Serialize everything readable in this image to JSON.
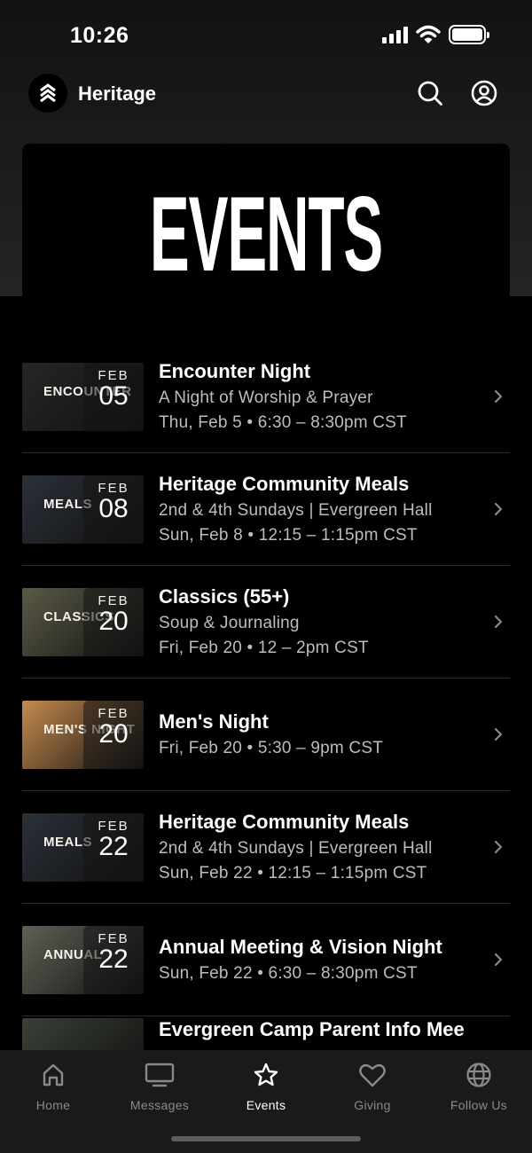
{
  "status_bar": {
    "time": "10:26"
  },
  "header": {
    "app_name": "Heritage"
  },
  "banner": {
    "title": "EVENTS"
  },
  "events": [
    {
      "title": "Encounter Night",
      "lines": [
        "A Night of Worship & Prayer",
        "Thu, Feb 5 • 6:30 – 8:30pm CST"
      ],
      "month": "FEB",
      "day": "05",
      "thumb_text": "ENCOUNTER",
      "thumb_color": "#262626"
    },
    {
      "title": "Heritage Community Meals",
      "lines": [
        "2nd & 4th Sundays  |  Evergreen Hall",
        "Sun, Feb 8 • 12:15 – 1:15pm CST"
      ],
      "month": "FEB",
      "day": "08",
      "thumb_text": "MEALS",
      "thumb_color": "#2b3038"
    },
    {
      "title": "Classics (55+)",
      "lines": [
        "Soup & Journaling",
        "Fri, Feb 20 • 12 – 2pm CST"
      ],
      "month": "FEB",
      "day": "20",
      "thumb_text": "CLASSICS",
      "thumb_color": "#5b5a47"
    },
    {
      "title": "Men's Night",
      "lines": [
        "Fri, Feb 20 • 5:30 – 9pm CST"
      ],
      "month": "FEB",
      "day": "20",
      "thumb_text": "MEN'S NIGHT",
      "thumb_color": "#c58a4e"
    },
    {
      "title": "Heritage Community Meals",
      "lines": [
        "2nd & 4th Sundays  |  Evergreen Hall",
        "Sun, Feb 22 • 12:15 – 1:15pm CST"
      ],
      "month": "FEB",
      "day": "22",
      "thumb_text": "MEALS",
      "thumb_color": "#2b3038"
    },
    {
      "title": "Annual Meeting & Vision Night",
      "lines": [
        "Sun, Feb 22 • 6:30 – 8:30pm CST"
      ],
      "month": "FEB",
      "day": "22",
      "thumb_text": "ANNUAL",
      "thumb_color": "#5e6156"
    },
    {
      "title": "Evergreen Camp Parent Info Mee",
      "lines": [],
      "month": "",
      "day": "",
      "thumb_text": "",
      "thumb_color": "#3a4036"
    }
  ],
  "tabs": [
    {
      "label": "Home",
      "icon": "home-icon"
    },
    {
      "label": "Messages",
      "icon": "monitor-icon"
    },
    {
      "label": "Events",
      "icon": "star-icon"
    },
    {
      "label": "Giving",
      "icon": "heart-icon"
    },
    {
      "label": "Follow Us",
      "icon": "globe-icon"
    }
  ],
  "active_tab": "Events"
}
